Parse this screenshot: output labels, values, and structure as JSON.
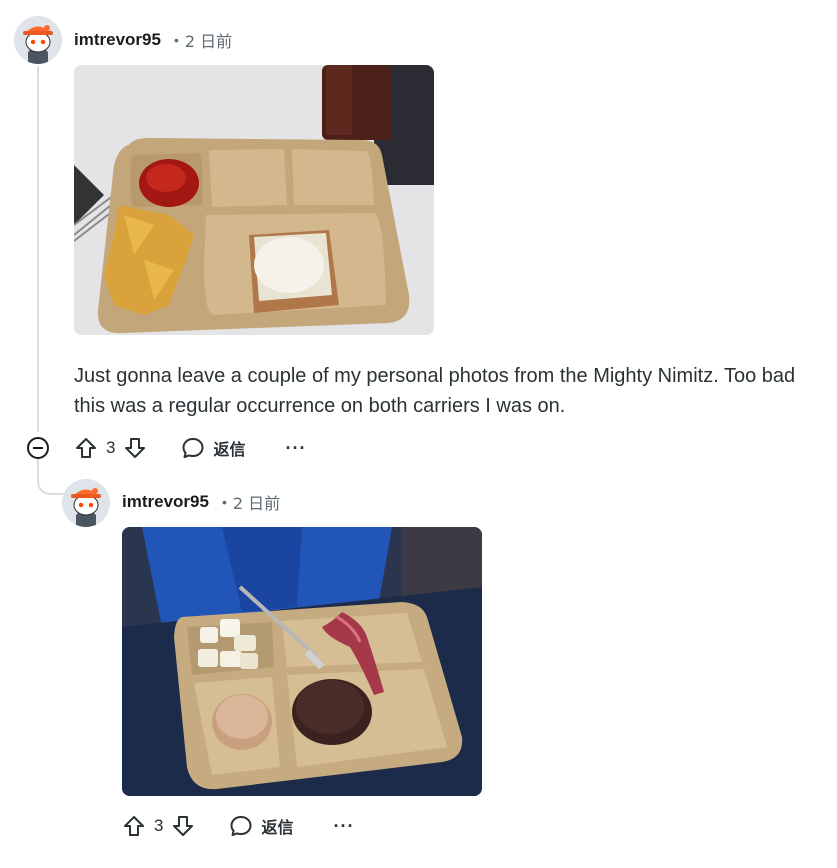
{
  "comments": [
    {
      "username": "imtrevor95",
      "time": "2 日前",
      "text": "Just gonna leave a couple of my personal photos from the Mighty Nimitz. Too bad this was a regular occurrence on both carriers I was on.",
      "score": "3",
      "reply_label": "返信",
      "more_label": "···"
    },
    {
      "username": "imtrevor95",
      "time": "2 日前",
      "score": "3",
      "reply_label": "返信",
      "more_label": "···"
    }
  ],
  "colors": {
    "meta_gray": "#5c6c74",
    "thread_line": "#d9dde0",
    "avatar_cap": "#ff6a2b"
  },
  "icons": [
    "upvote-icon",
    "downvote-icon",
    "comment-bubble-icon",
    "collapse-icon",
    "snoo-avatar"
  ]
}
